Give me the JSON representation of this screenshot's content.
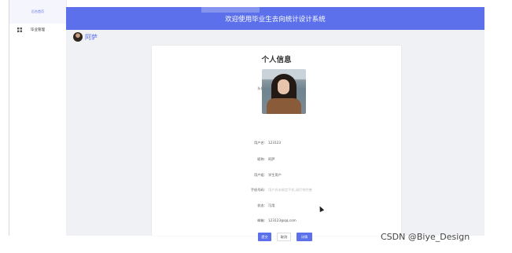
{
  "sidebar": {
    "head": "后台首页",
    "items": [
      {
        "label": "毕业管理",
        "icon": "grid-icon"
      }
    ]
  },
  "header": {
    "title": "欢迎使用毕业生去向统计设计系统"
  },
  "user": {
    "name": "阿萨"
  },
  "profile": {
    "title": "个人信息",
    "avatar_label": "头像:",
    "fields": [
      {
        "label": "用户名:",
        "value": "123123",
        "is_placeholder": false
      },
      {
        "label": "昵称:",
        "value": "阿萨",
        "is_placeholder": false
      },
      {
        "label": "用户组:",
        "value": "学生用户",
        "is_placeholder": false
      },
      {
        "label": "手机号码:",
        "value": "用户尚未绑定手机,请尽快完善",
        "is_placeholder": true
      },
      {
        "label": "状态:",
        "value": "可用",
        "is_placeholder": false
      },
      {
        "label": "邮箱:",
        "value": "123123@qq.com",
        "is_placeholder": false
      }
    ],
    "buttons": {
      "submit": "提交",
      "cancel": "取消",
      "back": "详情"
    }
  },
  "watermark": "CSDN @Biye_Design",
  "colors": {
    "accent": "#5b70ea",
    "background": "#f0f1f4"
  }
}
